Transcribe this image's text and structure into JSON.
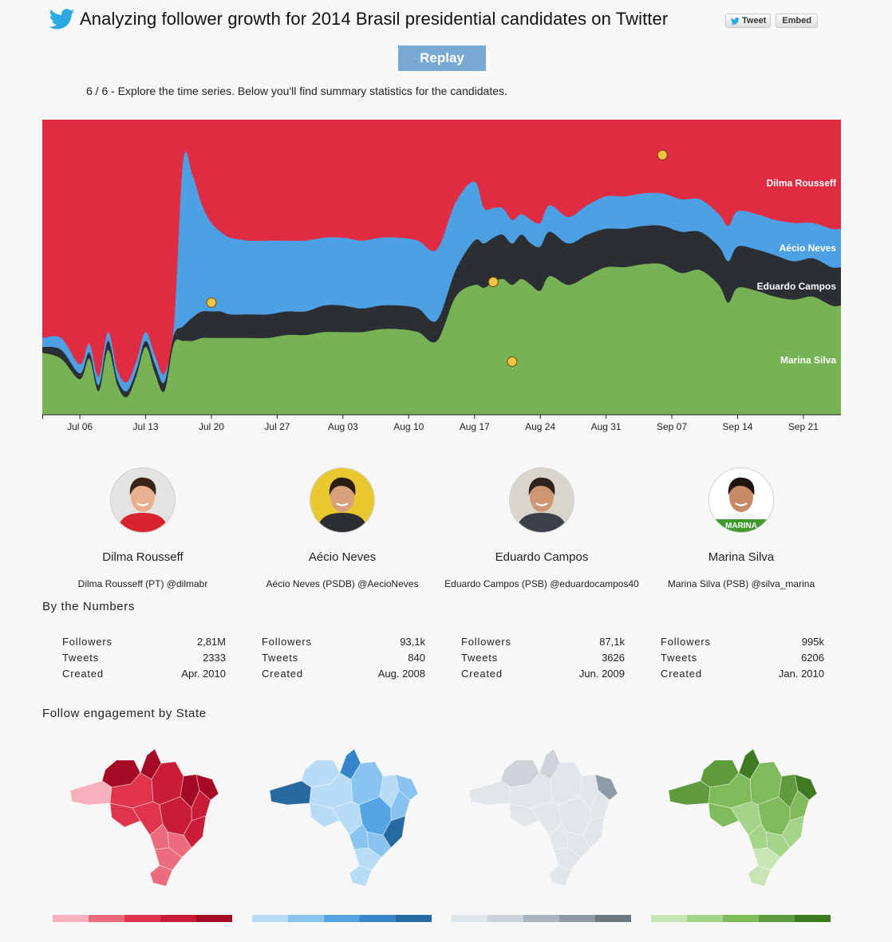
{
  "header": {
    "title": "Analyzing follower growth for 2014 Brasil presidential candidates on Twitter",
    "tweet_label": "Tweet",
    "embed_label": "Embed",
    "replay_label": "Replay",
    "step_text": "6 / 6 - Explore the time series. Below you'll find summary statistics for the candidates."
  },
  "chart_data": {
    "type": "area",
    "stacked": "normalized-100-percent",
    "title": "",
    "xlabel": "",
    "ylabel": "",
    "ylim": [
      0,
      100
    ],
    "x_tick_labels": [
      "Jul 06",
      "Jul 13",
      "Jul 20",
      "Jul 27",
      "Aug 03",
      "Aug 10",
      "Aug 17",
      "Aug 24",
      "Aug 31",
      "Sep 07",
      "Sep 14",
      "Sep 21"
    ],
    "x_range_days": [
      -4,
      81
    ],
    "x_days": [
      -4,
      -2,
      0,
      1,
      2,
      3,
      4,
      5,
      6,
      7,
      8,
      9,
      10,
      11,
      12,
      13,
      14,
      15,
      16,
      18,
      20,
      22,
      24,
      26,
      28,
      30,
      32,
      34,
      36,
      38,
      40,
      42,
      43,
      44,
      45,
      46,
      47,
      48,
      49,
      50,
      52,
      54,
      56,
      58,
      60,
      62,
      64,
      66,
      68,
      69,
      70,
      72,
      74,
      76,
      78,
      80,
      81
    ],
    "series": [
      {
        "name": "Marina Silva",
        "color": "#77b255",
        "values": [
          21,
          19,
          12,
          19,
          8,
          22,
          10,
          6,
          13,
          23,
          14,
          8,
          24,
          25,
          25,
          26,
          26,
          26,
          26,
          26,
          26,
          27,
          27,
          28,
          28,
          28,
          29,
          29,
          28,
          25,
          40,
          44,
          43,
          45,
          46,
          44,
          46,
          44,
          42,
          47,
          44,
          47,
          50,
          50,
          51,
          51,
          48,
          49,
          44,
          38,
          43,
          42,
          40,
          39,
          40,
          37,
          37
        ]
      },
      {
        "name": "Eduardo Campos",
        "color": "#2b2e33",
        "values": [
          2,
          3,
          2,
          2,
          2,
          3,
          2,
          2,
          2,
          2,
          3,
          3,
          3,
          5,
          8,
          9,
          9,
          9,
          8,
          8,
          8,
          8,
          8,
          9,
          9,
          8,
          8,
          8,
          8,
          7,
          9,
          15,
          15,
          15,
          15,
          14,
          15,
          14,
          15,
          15,
          14,
          14,
          13,
          13,
          13,
          13,
          14,
          13,
          13,
          14,
          14,
          14,
          14,
          13,
          13,
          13,
          13
        ]
      },
      {
        "name": "Aécio Neves",
        "color": "#4ea0e4",
        "values": [
          3,
          4,
          3,
          3,
          3,
          3,
          3,
          3,
          3,
          3,
          3,
          3,
          3,
          56,
          48,
          36,
          30,
          27,
          26,
          25,
          25,
          24,
          24,
          23,
          23,
          23,
          23,
          23,
          23,
          24,
          23,
          20,
          12,
          10,
          9,
          8,
          7,
          8,
          8,
          9,
          9,
          10,
          11,
          11,
          11,
          11,
          11,
          11,
          11,
          12,
          12,
          12,
          12,
          13,
          12,
          13,
          13
        ]
      },
      {
        "name": "Dilma Rousseff",
        "color": "#df2c42",
        "values": [
          74,
          74,
          83,
          76,
          87,
          72,
          85,
          89,
          82,
          72,
          80,
          86,
          70,
          14,
          19,
          29,
          35,
          38,
          40,
          41,
          41,
          41,
          41,
          40,
          40,
          41,
          40,
          40,
          41,
          44,
          28,
          21,
          30,
          30,
          30,
          34,
          32,
          34,
          35,
          29,
          33,
          29,
          26,
          26,
          25,
          25,
          27,
          27,
          32,
          36,
          31,
          32,
          34,
          35,
          35,
          37,
          37
        ]
      }
    ],
    "legend_placement": "right",
    "annotation_markers": [
      {
        "day": 14,
        "value": 38,
        "color": "#f6c443"
      },
      {
        "day": 44,
        "value": 45,
        "color": "#f6c443"
      },
      {
        "day": 46,
        "value": 18,
        "color": "#f6c443"
      },
      {
        "day": 62,
        "value": 88,
        "color": "#f6c443"
      }
    ]
  },
  "candidates": [
    {
      "name": "Dilma Rousseff",
      "handle": "Dilma Rousseff (PT) @dilmabr",
      "followers": "2,81M",
      "tweets": "2333",
      "created": "Apr. 2010",
      "accent": "#df2c42"
    },
    {
      "name": "Aécio Neves",
      "handle": "Aécio Neves (PSDB) @AecioNeves",
      "followers": "93,1k",
      "tweets": "840",
      "created": "Aug. 2008",
      "accent": "#4ea0e4"
    },
    {
      "name": "Eduardo Campos",
      "handle": "Eduardo Campos (PSB) @eduardocampos40",
      "followers": "87,1k",
      "tweets": "3626",
      "created": "Jun. 2009",
      "accent": "#2b2e33"
    },
    {
      "name": "Marina Silva",
      "handle": "Marina Silva (PSB) @silva_marina",
      "followers": "995k",
      "tweets": "6206",
      "created": "Jan. 2010",
      "accent": "#77b255"
    }
  ],
  "stats_labels": {
    "followers": "Followers",
    "tweets": "Tweets",
    "created": "Created"
  },
  "sections": {
    "numbers": "By the Numbers",
    "engagement": "Follow engagement by State"
  },
  "avatar_badge_text": "MARINA",
  "palettes": [
    [
      "#f7b0bd",
      "#ec6b7c",
      "#e0334c",
      "#c91c38",
      "#a40a25"
    ],
    [
      "#b8dcf5",
      "#88c4ef",
      "#55a5e4",
      "#3585c8",
      "#276aa0"
    ],
    [
      "#e1e6ea",
      "#cdd3d9",
      "#aab4be",
      "#8e9aa6",
      "#6d7782"
    ],
    [
      "#c8e5b5",
      "#a4d38a",
      "#7fbb5b",
      "#5f9a3c",
      "#3e7a22"
    ]
  ]
}
